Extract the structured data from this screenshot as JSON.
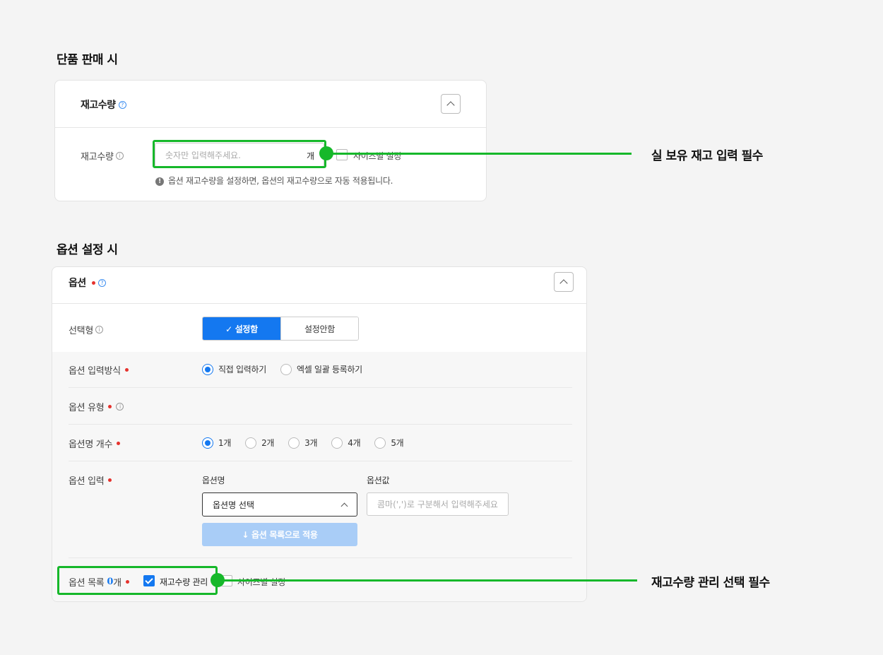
{
  "section1": {
    "heading": "단품 판매 시",
    "card_title": "재고수량",
    "help": "?",
    "stock_label": "재고수량",
    "info": "i",
    "stock_placeholder": "숫자만 입력해주세요.",
    "unit": "개",
    "size_setting_label": "사이즈별 설정",
    "hint_icon": "!",
    "hint": "옵션 재고수량을 설정하면, 옵션의 재고수량으로 자동 적용됩니다."
  },
  "section2": {
    "heading": "옵션 설정 시",
    "card_title": "옵션",
    "help": "?",
    "info": "i",
    "select_type_label": "선택형",
    "toggle_on": "✓ 설정함",
    "toggle_off": "설정안함",
    "input_method_label": "옵션 입력방식",
    "input_method_options": [
      "직접 입력하기",
      "엑셀 일괄 등록하기"
    ],
    "option_type_label": "옵션 유형",
    "option_count_label": "옵션명 개수",
    "option_count_options": [
      "1개",
      "2개",
      "3개",
      "4개",
      "5개"
    ],
    "option_input_label": "옵션 입력",
    "col_name": "옵션명",
    "col_value": "옵션값",
    "name_select": "옵션명 선택",
    "value_placeholder": "콤마(',')로 구분해서 입력해주세요",
    "apply_button": "↓ 옵션 목록으로 적용",
    "list_label": "옵션 목록",
    "list_count": "0",
    "list_count_unit": "개",
    "stock_manage_label": "재고수량 관리",
    "size_setting_label": "사이즈별 설정"
  },
  "annotations": {
    "first": "실 보유 재고 입력 필수",
    "second": "재고수량 관리 선택 필수"
  },
  "colors": {
    "accent": "#1478f0",
    "highlight": "#16b82a",
    "required": "#e5322d"
  }
}
